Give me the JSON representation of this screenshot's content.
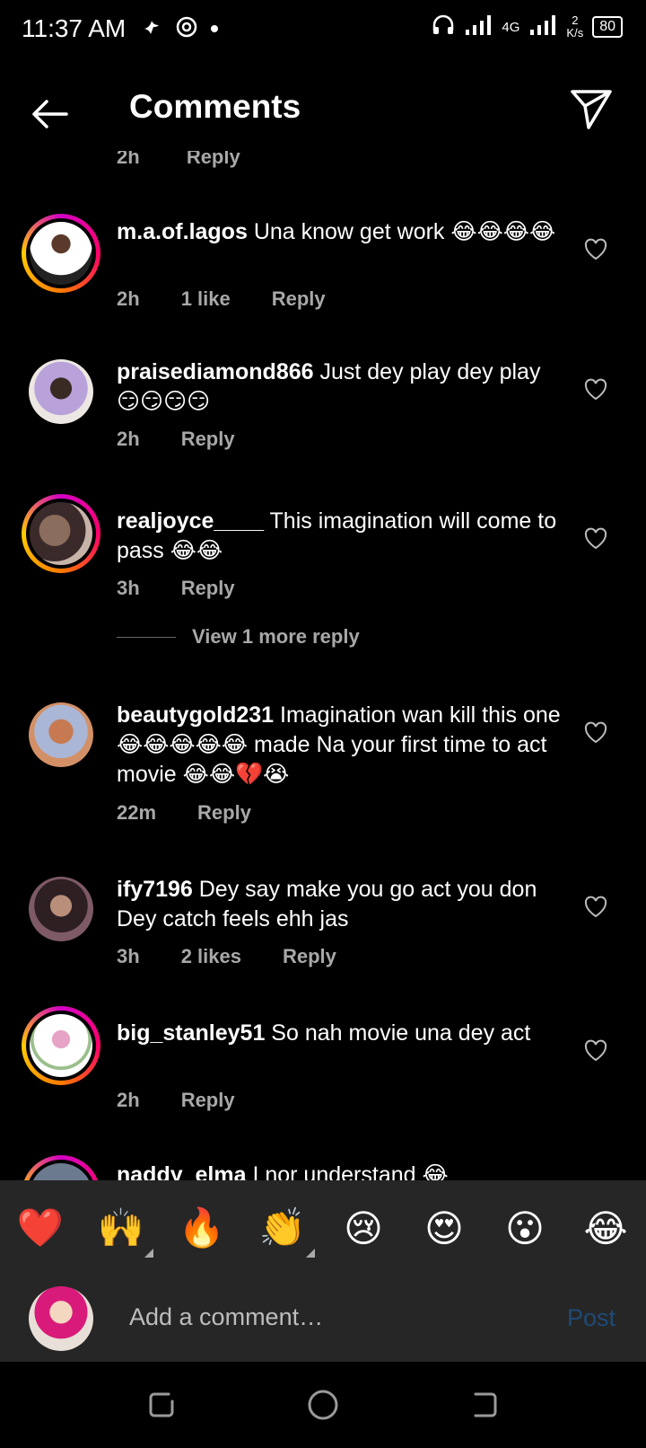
{
  "status_bar": {
    "time": "11:37 AM",
    "network": "4G",
    "speed_value": "2",
    "speed_unit": "K/s",
    "battery": "80"
  },
  "header": {
    "title": "Comments"
  },
  "partial_comment": {
    "time": "2h",
    "reply": "Reply"
  },
  "comments": [
    {
      "username": "m.a.of.lagos",
      "text": " Una know get work 😂😂😂😂",
      "time": "2h",
      "likes": "1 like",
      "reply": "Reply",
      "avatar_color": "#e9e4de"
    },
    {
      "username": "praisediamond866",
      "text": " Just dey play dey play 😏😏😏😏",
      "time": "2h",
      "likes": "",
      "reply": "Reply",
      "avatar_color": "#b8a2d9"
    },
    {
      "username": "realjoyce____",
      "text": " This imagination will come to pass 😂😂",
      "time": "3h",
      "likes": "",
      "reply": "Reply",
      "avatar_color": "#8a6d5c"
    },
    {
      "username": "beautygold231",
      "text": " Imagination wan kill this one 😂😂😂😂😂 made Na your first time to act movie 😂😂💔😭",
      "time": "22m",
      "likes": "",
      "reply": "Reply",
      "avatar_color": "#c77a52"
    },
    {
      "username": "ify7196",
      "text": " Dey say make you go act you don Dey catch feels ehh jas",
      "time": "3h",
      "likes": "2 likes",
      "reply": "Reply",
      "avatar_color": "#7d5a66"
    },
    {
      "username": "big_stanley51",
      "text": " So nah movie una dey act",
      "time": "2h",
      "likes": "",
      "reply": "Reply",
      "avatar_color": "#f2f2f2"
    },
    {
      "username": "naddy_elma",
      "text": " I nor understand 😂"
    }
  ],
  "view_more": "View 1 more reply",
  "emoji_bar": [
    "❤️",
    "🙌",
    "🔥",
    "👏",
    "😢",
    "😍",
    "😮",
    "😂"
  ],
  "composer": {
    "placeholder": "Add a comment…",
    "post": "Post"
  }
}
